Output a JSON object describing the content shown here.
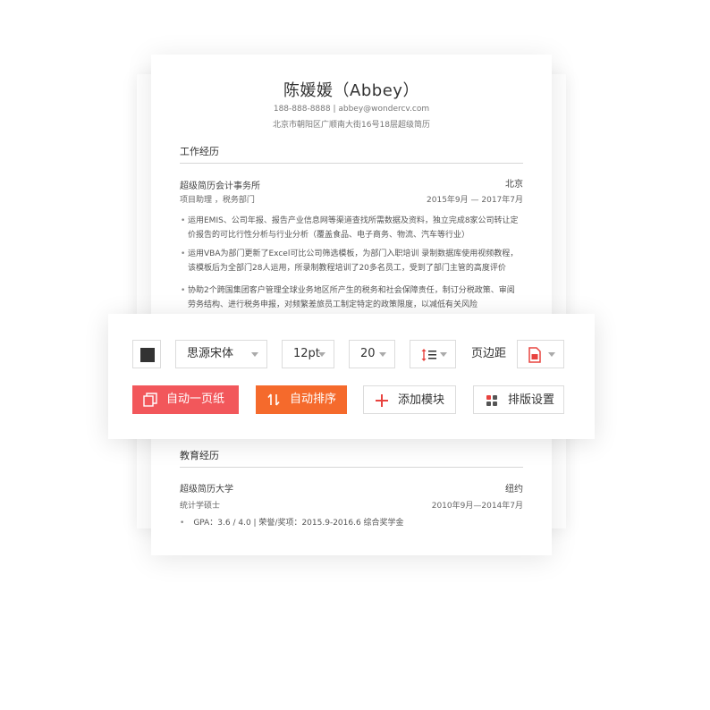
{
  "resume": {
    "name": "陈媛媛（Abbey）",
    "contact": "188-888-8888 | abbey@wondercv.com",
    "address": "北京市朝阳区广顺南大街16号18层超级简历",
    "work": {
      "title": "工作经历",
      "org": "超级简历会计事务所",
      "location": "北京",
      "role": "项目助理 ，税务部门",
      "dates": "2015年9月 — 2017年7月",
      "bullets": [
        "运用EMIS、公司年报、报告产业信息网等渠道查找所需数据及资料，独立完成8家公司转让定价报告的可比行性分析与行业分析（覆盖食品、电子商务、物流、汽车等行业）",
        "运用VBA为部门更新了Excel可比公司筛选模板，为部门入职培训 录制数据库使用视频教程，该模板后为全部门28人运用，所录制教程培训了20多名员工，受到了部门主管的高度评价",
        "协助2个跨国集团客户管理全球业务地区所产生的税务和社会保障责任，制订分税政策、审阅劳务结构、进行税务申报，对频繁差旅员工制定特定的政策限度，以减低有关风险"
      ]
    },
    "education": {
      "title": "教育经历",
      "school": "超级简历大学",
      "location": "纽约",
      "degree": "统计学硕士",
      "dates": "2010年9月—2014年7月",
      "gpa": "GPA：3.6 / 4.0 | 荣誉/奖项：2015.9-2016.6 综合奖学金"
    }
  },
  "toolbar": {
    "font": "思源宋体",
    "font_size": "12pt",
    "line_spacing": "20",
    "margin_label": "页边距",
    "buttons": {
      "auto_page": "自动一页纸",
      "auto_sort": "自动排序",
      "add_module": "添加模块",
      "layout_settings": "排版设置"
    }
  },
  "icons": {
    "color": "color-swatch",
    "line_height": "line-height-icon",
    "page": "page-size-icon",
    "auto_page": "copy-pages-icon",
    "auto_sort": "sort-arrows-icon",
    "add": "plus-icon",
    "layout": "grid-icon"
  },
  "colors": {
    "accent_red": "#f2575b",
    "accent_orange": "#f56a2c",
    "text_color": "#333333"
  }
}
